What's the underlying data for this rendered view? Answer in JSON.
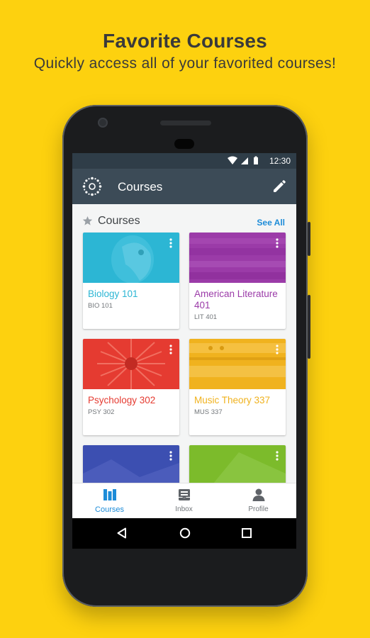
{
  "promo": {
    "headline": "Favorite Courses",
    "subline": "Quickly access all of your favorited courses!"
  },
  "status_bar": {
    "time": "12:30"
  },
  "app_bar": {
    "title": "Courses",
    "logo_icon": "canvas-logo-icon",
    "edit_icon": "pencil-icon"
  },
  "section": {
    "title": "Courses",
    "star_icon": "star-icon",
    "see_all": "See All"
  },
  "courses": [
    {
      "name": "Biology 101",
      "code": "BIO 101",
      "color": "#2CB6D4"
    },
    {
      "name": "American Literature 401",
      "code": "LIT 401",
      "color": "#9B3BA8"
    },
    {
      "name": "Psychology 302",
      "code": "PSY 302",
      "color": "#E53B31"
    },
    {
      "name": "Music Theory 337",
      "code": "MUS 337",
      "color": "#F0B21E"
    },
    {
      "name": "",
      "code": "",
      "color": "#3C4FB1"
    },
    {
      "name": "",
      "code": "",
      "color": "#7CBB2B"
    }
  ],
  "bottom_nav": [
    {
      "label": "Courses",
      "icon": "courses-icon",
      "active": true
    },
    {
      "label": "Inbox",
      "icon": "inbox-icon",
      "active": false
    },
    {
      "label": "Profile",
      "icon": "profile-icon",
      "active": false
    }
  ],
  "system_nav": {
    "back_icon": "back-icon",
    "home_icon": "home-icon",
    "recents_icon": "recents-icon"
  },
  "colors": {
    "background": "#FDD10F",
    "app_bar": "#3C4B57",
    "accent": "#1D8CD8"
  }
}
